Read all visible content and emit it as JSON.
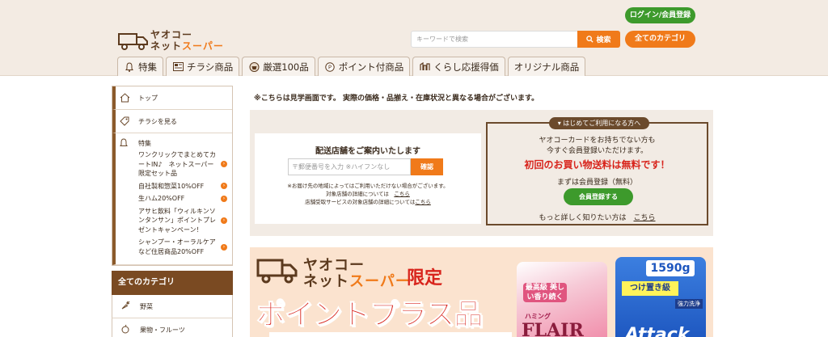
{
  "header": {
    "logo_line1": "ヤオコー",
    "logo_line2_a": "ネット",
    "logo_line2_b": "スーパー",
    "login_label": "ログイン/会員登録",
    "search_placeholder": "キーワードで検索",
    "search_button": "検索",
    "all_categories_button": "全てのカテゴリ"
  },
  "nav": {
    "tabs": [
      {
        "label": "特集",
        "icon": "bell-icon"
      },
      {
        "label": "チラシ商品",
        "icon": "flyer-icon"
      },
      {
        "label": "厳選100品",
        "icon": "basket-icon"
      },
      {
        "label": "ポイント付商品",
        "icon": "point-icon"
      },
      {
        "label": "くらし応援得価",
        "icon": "price-icon"
      },
      {
        "label": "オリジナル商品",
        "icon": ""
      }
    ]
  },
  "sidebar": {
    "top": "トップ",
    "flyer": "チラシを見る",
    "feature_title": "特集",
    "features": [
      "ワンクリックでまとめてカートIN♪　ネットスーパー限定セット品",
      "自社製和惣菜10%OFF",
      "生ハム20%OFF",
      "アサヒ飲料「ウィルキンソンタンサン」ポイントプレゼントキャンペーン！",
      "シャンプー・オーラルケアなど住居商品20%OFF"
    ],
    "all_categories": "全てのカテゴリ",
    "categories": [
      "野菜",
      "果物・フルーツ"
    ]
  },
  "main": {
    "notice": "※こちらは見学画面です。 実際の価格・品揃え・在庫状況と異なる場合がございます。",
    "store": {
      "title": "配送店舗をご案内いたします",
      "zip_placeholder": "〒郵便番号を入力 ※ハイフンなし",
      "confirm_button": "確認",
      "note1": "※お届け先の地域によってはご利用いただけない場合がございます。",
      "note2_text": "対象店舗の詳細については",
      "note2_link": "こちら",
      "note3_text": "店舗受取サービスの対象店舗の詳細については",
      "note3_link": "こちら"
    },
    "member": {
      "tag": "はじめてご利用になる方へ",
      "line1": "ヤオコーカードをお持ちでない方も",
      "line2": "今すぐ会員登録いただけます。",
      "red": "初回のお買い物送料は無料です！",
      "line3": "まずは会員登録（無料）",
      "button": "会員登録する",
      "more_text": "もっと詳しく知りたい方は",
      "more_link": "こちら"
    },
    "banner": {
      "line1": "ヤオコー",
      "line2_a": "ネット",
      "line2_b": "スーパー",
      "limited": "限定",
      "big": "ポイントプラス品",
      "prod1_label": "最高級 美しい香り続く",
      "prod1_brand": "ハミング",
      "prod1_name": "FLAIR",
      "prod2_badge": "1590g",
      "prod2_tag": "つけ置き級",
      "prod2_sub": "強力洗浄",
      "prod2_name": "Attack"
    }
  }
}
